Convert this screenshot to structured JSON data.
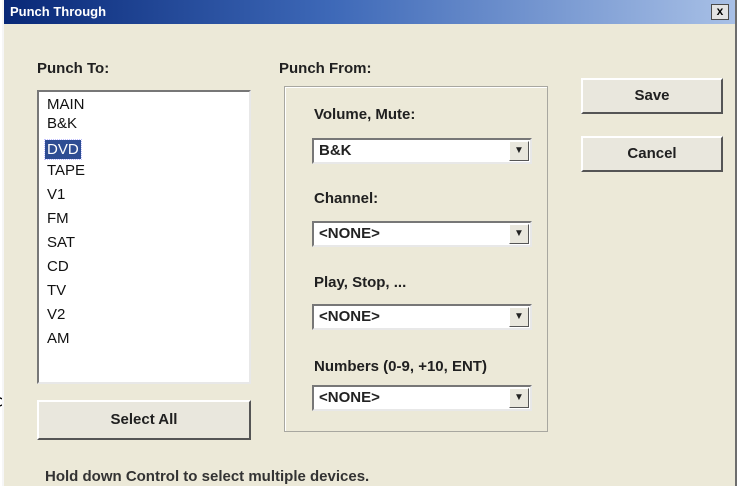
{
  "window": {
    "title": "Punch Through",
    "close_label": "x"
  },
  "punch_to": {
    "label": "Punch To:",
    "items": [
      "MAIN",
      "B&K",
      "DVD",
      "TAPE",
      "V1",
      "FM",
      "SAT",
      "CD",
      "TV",
      "V2",
      "AM"
    ],
    "selected": "DVD",
    "select_all_label": "Select All"
  },
  "punch_from": {
    "label": "Punch From:",
    "volume": {
      "label": "Volume, Mute:",
      "value": "B&K"
    },
    "channel": {
      "label": "Channel:",
      "value": "<NONE>"
    },
    "play": {
      "label": "Play, Stop, ...",
      "value": "<NONE>"
    },
    "numbers": {
      "label": "Numbers (0-9, +10, ENT)",
      "value": "<NONE>"
    }
  },
  "buttons": {
    "save": "Save",
    "cancel": "Cancel"
  },
  "hint": "Hold down Control to select multiple devices.",
  "colors": {
    "selection": "#2e4d93",
    "titlebar": "#082877",
    "dialog_bg": "#ece9d8"
  }
}
